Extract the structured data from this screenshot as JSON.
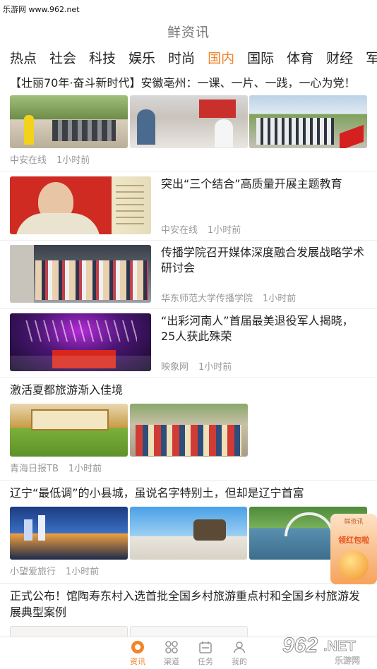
{
  "watermark": "乐游网 www.962.net",
  "header": {
    "title": "鲜资讯"
  },
  "tabs": [
    "热点",
    "社会",
    "科技",
    "娱乐",
    "时尚",
    "国内",
    "国际",
    "体育",
    "财经",
    "军事"
  ],
  "active_tab_index": 5,
  "colors": {
    "accent": "#f0852a",
    "meta_text": "#999999"
  },
  "feed": {
    "item1": {
      "title": "【壮丽70年·奋斗新时代】安徽亳州：一课、一片、一践，一心为党！",
      "source": "中安在线",
      "time": "1小时前"
    },
    "item2": {
      "title": "突出“三个结合”高质量开展主题教育",
      "source": "中安在线",
      "time": "1小时前"
    },
    "item3": {
      "title": "传播学院召开媒体深度融合发展战略学术研讨会",
      "source": "华东师范大学传播学院",
      "time": "1小时前"
    },
    "item4": {
      "title": "“出彩河南人”首届最美退役军人揭晓，25人获此殊荣",
      "source": "映象网",
      "time": "1小时前"
    },
    "item5": {
      "title": "激活夏都旅游渐入佳境",
      "source": "青海日报TB",
      "time": "1小时前"
    },
    "item6": {
      "title": "辽宁“最低调”的小县城，虽说名字特别土，但却是辽宁首富",
      "source": "小望爱旅行",
      "time": "1小时前"
    },
    "item7": {
      "title": "正式公布！馆陶寿东村入选首批全国乡村旅游重点村和全国乡村旅游发展典型案例"
    }
  },
  "float_ad": {
    "top": "鲜资讯",
    "label": "领红包啦"
  },
  "bottom_nav": [
    {
      "label": "资讯",
      "icon": "news-icon"
    },
    {
      "label": "渠道",
      "icon": "grid-icon"
    },
    {
      "label": "任务",
      "icon": "task-icon"
    },
    {
      "label": "我的",
      "icon": "user-icon"
    }
  ],
  "brand_logo": {
    "main": "962",
    "suffix": ".NET",
    "sub": "乐游网"
  }
}
